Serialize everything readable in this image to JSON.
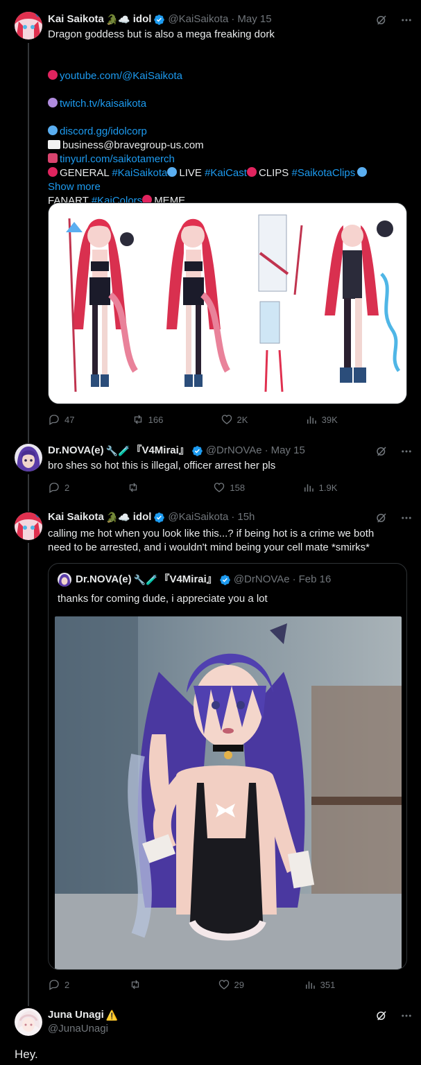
{
  "tweets": [
    {
      "name": "Kai Saikota",
      "name_emoji": "🐊☁️",
      "name_tag": "idol",
      "handle": "@KaiSaikota",
      "time": "May 15",
      "bio": "Dragon goddess but is also a mega freaking dork",
      "links": [
        "youtube.com/@KaiSaikota",
        "twitch.tv/kaisaikota",
        "discord.gg/idolcorp",
        "tinyurl.com/saikotamerch"
      ],
      "business": "business@bravegroup-us.com",
      "tags_line1": {
        "general": "GENERAL",
        "general_tag": "#KaiSaikota",
        "live": "LIVE",
        "live_tag": "#KaiCast",
        "clips": "CLIPS",
        "clips_tag": "#SaikotaClips"
      },
      "tags_line2": {
        "fanart": "FANART",
        "fanart_tag": "#KaiColors",
        "meme": "MEME"
      },
      "show_more": "Show more",
      "stats": {
        "replies": "47",
        "retweets": "166",
        "likes": "2K",
        "views": "39K"
      }
    },
    {
      "name": "Dr.NOVA(e)",
      "name_emoji": "🔧🧪",
      "name_tag": "『V4Mirai』",
      "handle": "@DrNOVAe",
      "time": "May 15",
      "body": "bro shes so hot this is illegal, officer arrest her pls",
      "stats": {
        "replies": "2",
        "retweets": "",
        "likes": "158",
        "views": "1.9K"
      }
    },
    {
      "name": "Kai Saikota",
      "name_emoji": "🐊☁️",
      "name_tag": "idol",
      "handle": "@KaiSaikota",
      "time": "15h",
      "body": "calling me hot when you look like this...? if being hot is a crime we both\nneed to be arrested, and i wouldn't mind being your cell mate *smirks*",
      "quote": {
        "name": "Dr.NOVA(e)",
        "name_emoji": "🔧🧪",
        "name_tag": "『V4Mirai』",
        "handle": "@DrNOVAe",
        "time": "Feb 16",
        "body": "thanks for coming dude, i appreciate you a lot"
      },
      "stats": {
        "replies": "2",
        "retweets": "",
        "likes": "29",
        "views": "351"
      }
    },
    {
      "name": "Juna Unagi",
      "name_emoji": "⚠️",
      "handle": "@JunaUnagi",
      "body": "Hey."
    }
  ],
  "colors": {
    "background": "#000000",
    "text": "#e7e9ea",
    "muted": "#71767b",
    "link": "#1d9bf0",
    "border": "#2f3336"
  }
}
